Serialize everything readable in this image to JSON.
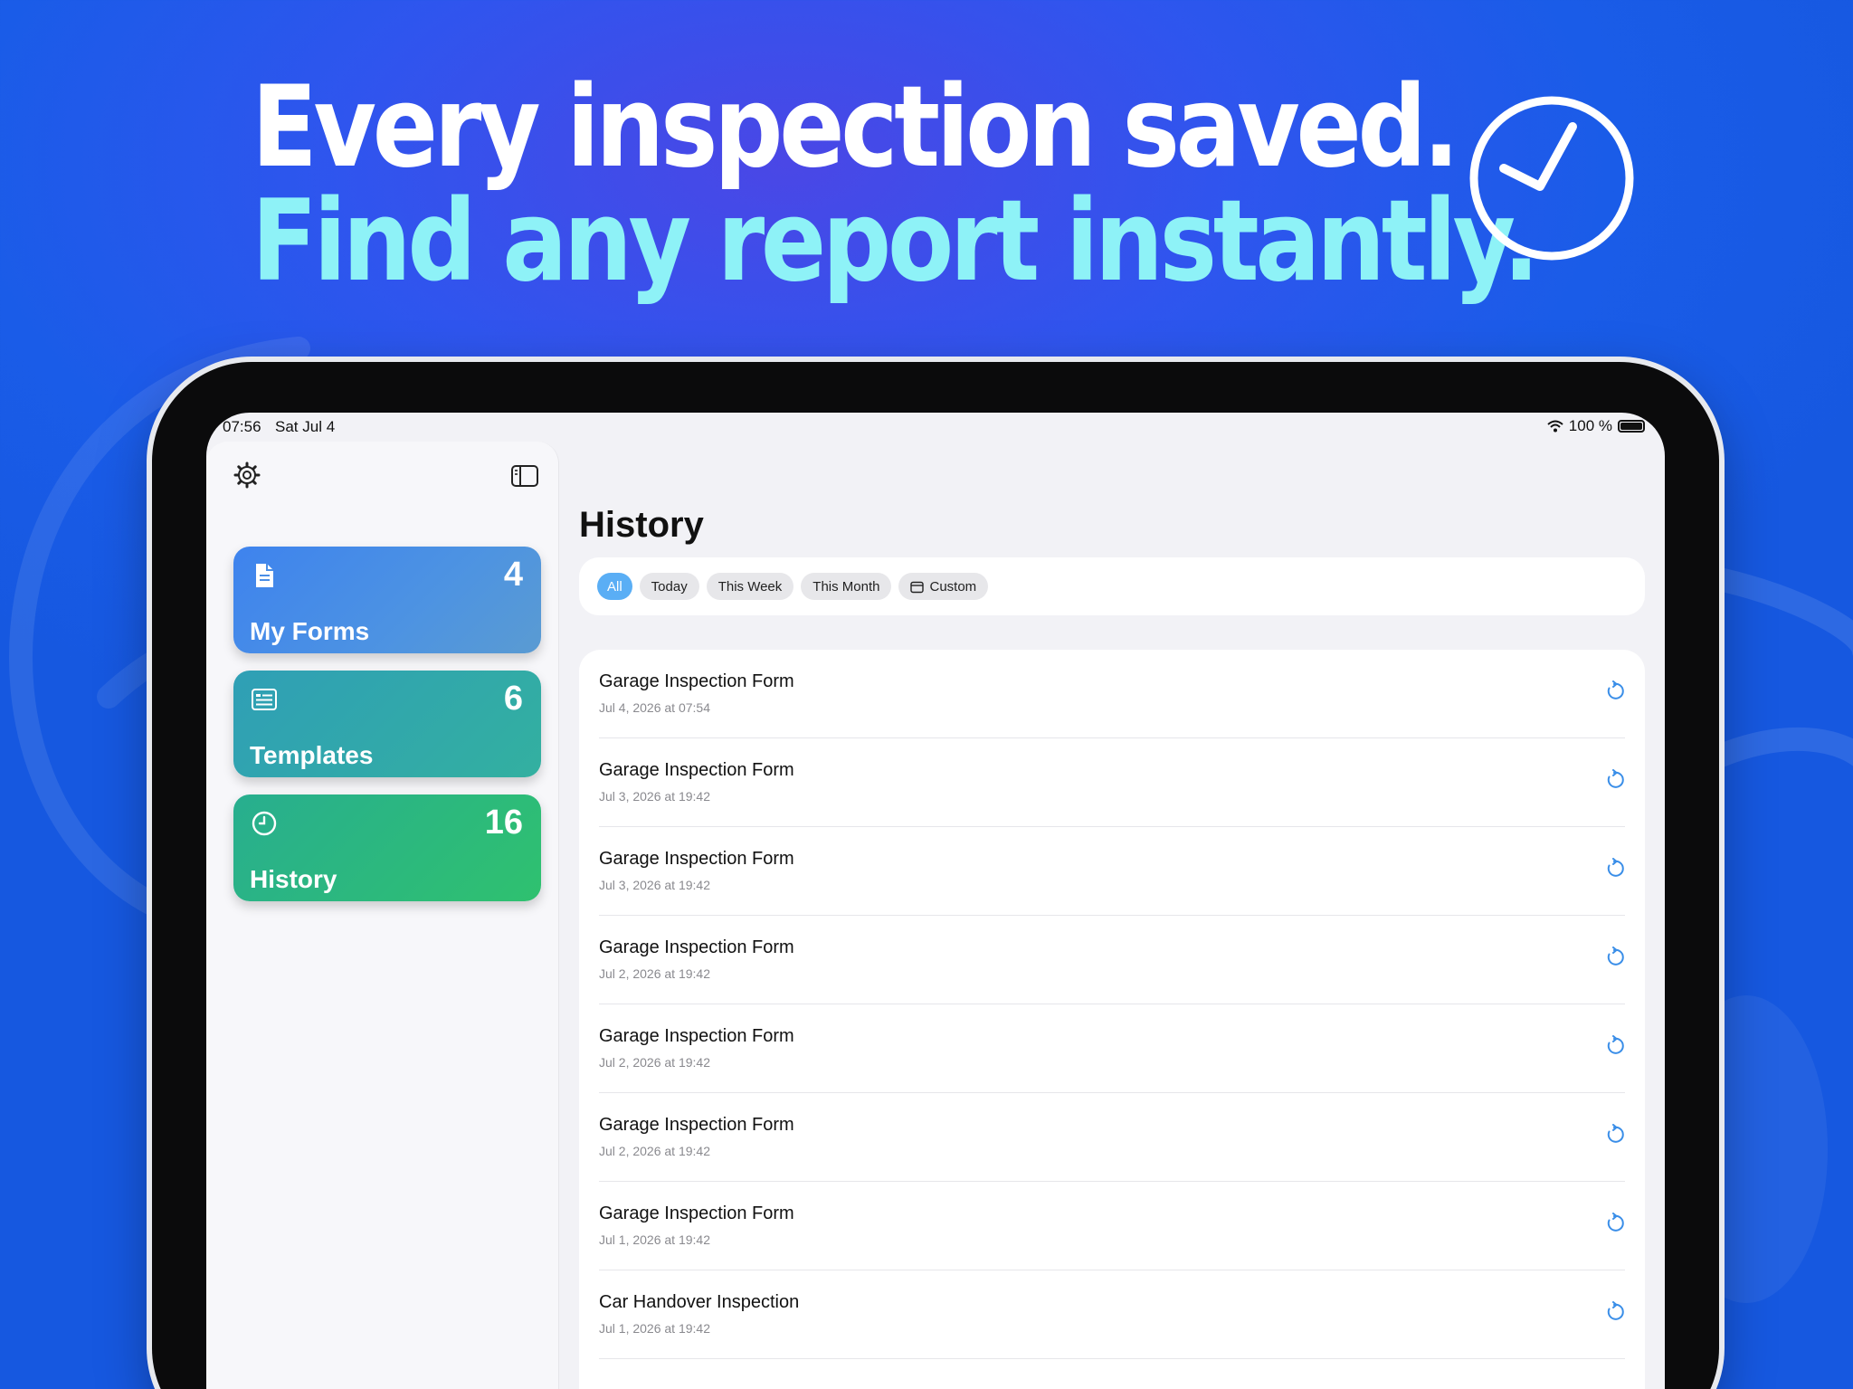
{
  "headline": {
    "line1": "Every inspection saved.",
    "line2": "Find any report instantly."
  },
  "status_bar": {
    "time": "07:56",
    "date": "Sat Jul 4",
    "battery": "100 %"
  },
  "sidebar": {
    "cards": [
      {
        "label": "My Forms",
        "count": "4",
        "icon": "document-icon",
        "color": "#4a8ee6"
      },
      {
        "label": "Templates",
        "count": "6",
        "icon": "list-icon",
        "color": "#31a8aa"
      },
      {
        "label": "History",
        "count": "16",
        "icon": "clock-icon",
        "color": "#2bb97e"
      }
    ]
  },
  "main": {
    "title": "History",
    "filters": [
      {
        "label": "All",
        "active": true
      },
      {
        "label": "Today",
        "active": false
      },
      {
        "label": "This Week",
        "active": false
      },
      {
        "label": "This Month",
        "active": false
      },
      {
        "label": "Custom",
        "active": false,
        "icon": "calendar-icon"
      }
    ],
    "items": [
      {
        "title": "Garage Inspection Form",
        "date": "Jul 4, 2026 at 07:54"
      },
      {
        "title": "Garage Inspection Form",
        "date": "Jul 3, 2026 at 19:42"
      },
      {
        "title": "Garage Inspection Form",
        "date": "Jul 3, 2026 at 19:42"
      },
      {
        "title": "Garage Inspection Form",
        "date": "Jul 2, 2026 at 19:42"
      },
      {
        "title": "Garage Inspection Form",
        "date": "Jul 2, 2026 at 19:42"
      },
      {
        "title": "Garage Inspection Form",
        "date": "Jul 2, 2026 at 19:42"
      },
      {
        "title": "Garage Inspection Form",
        "date": "Jul 1, 2026 at 19:42"
      },
      {
        "title": "Car Handover Inspection",
        "date": "Jul 1, 2026 at 19:42"
      }
    ]
  },
  "colors": {
    "accent": "#5aaef5",
    "headline_secondary": "#8ef2f7",
    "background": "#1a5ce8"
  }
}
